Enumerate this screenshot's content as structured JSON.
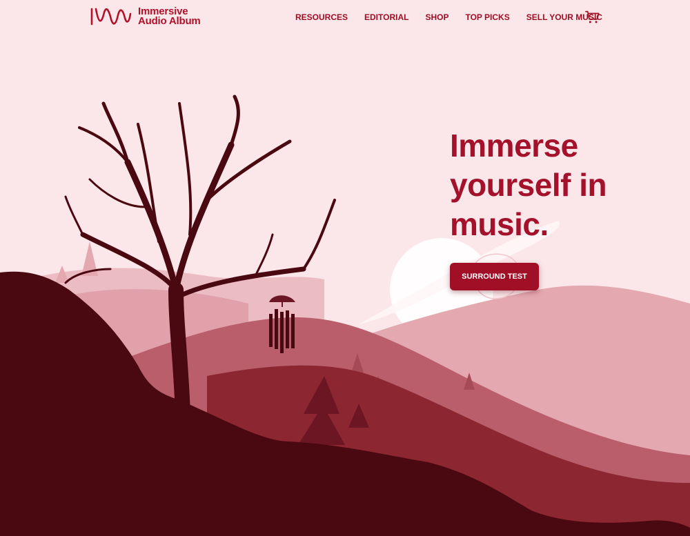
{
  "brand": {
    "name_line1": "Immersive",
    "name_line2": "Audio Album",
    "logo_icon": "wave-logo-icon"
  },
  "nav": {
    "items": [
      {
        "label": "RESOURCES"
      },
      {
        "label": "EDITORIAL"
      },
      {
        "label": "SHOP"
      },
      {
        "label": "TOP PICKS"
      },
      {
        "label": "SELL YOUR MUSIC"
      }
    ],
    "cart_icon": "cart-icon"
  },
  "hero": {
    "title_lines": [
      "Immerse",
      "yourself in",
      "music."
    ],
    "cta_label": "SURROUND TEST"
  },
  "colors": {
    "background": "#fbe6e9",
    "accent": "#a4112a",
    "hill_far": "#e3a8b0",
    "hill_mid": "#b95e6a",
    "hill_near": "#8c2631",
    "foreground": "#4a0811"
  }
}
